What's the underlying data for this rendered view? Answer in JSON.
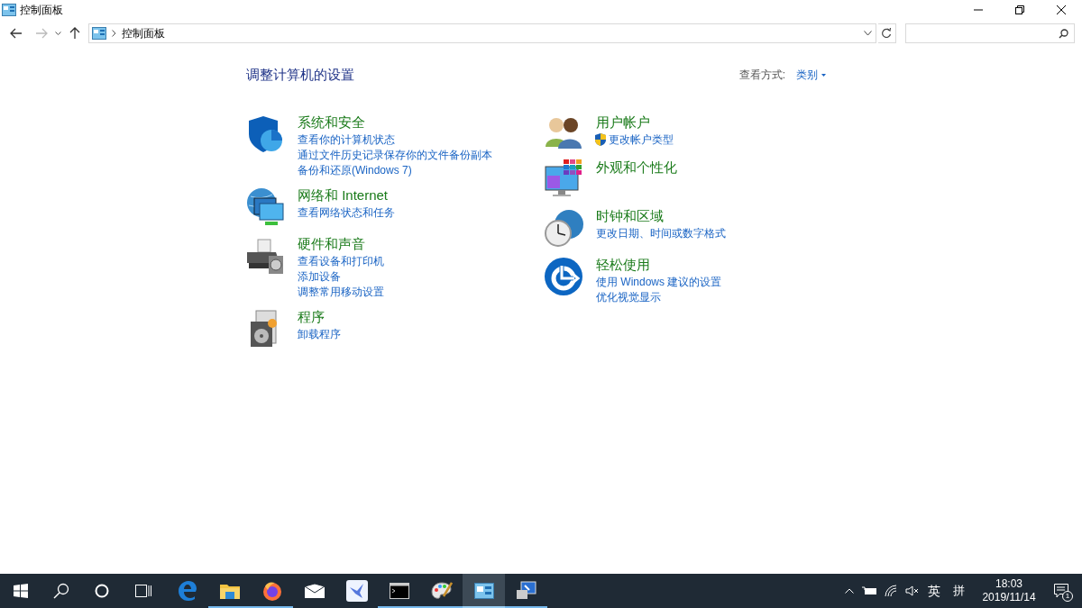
{
  "window": {
    "title": "控制面板"
  },
  "address_bar": {
    "crumb": "控制面板"
  },
  "heading": "调整计算机的设置",
  "view_by": {
    "label": "查看方式:",
    "value": "类别"
  },
  "columns": [
    {
      "categories": [
        {
          "title": "系统和安全",
          "links": [
            {
              "text": "查看你的计算机状态",
              "shield": false
            },
            {
              "text": "通过文件历史记录保存你的文件备份副本",
              "shield": false
            },
            {
              "text": "备份和还原(Windows 7)",
              "shield": false
            }
          ]
        },
        {
          "title": "网络和 Internet",
          "links": [
            {
              "text": "查看网络状态和任务",
              "shield": false
            }
          ]
        },
        {
          "title": "硬件和声音",
          "links": [
            {
              "text": "查看设备和打印机",
              "shield": false
            },
            {
              "text": "添加设备",
              "shield": false
            },
            {
              "text": "调整常用移动设置",
              "shield": false
            }
          ]
        },
        {
          "title": "程序",
          "links": [
            {
              "text": "卸载程序",
              "shield": false
            }
          ]
        }
      ]
    },
    {
      "categories": [
        {
          "title": "用户帐户",
          "links": [
            {
              "text": "更改帐户类型",
              "shield": true
            }
          ]
        },
        {
          "title": "外观和个性化"
        },
        {
          "title": "时钟和区域",
          "links": [
            {
              "text": "更改日期、时间或数字格式",
              "shield": false
            }
          ]
        },
        {
          "title": "轻松使用",
          "links": [
            {
              "text": "使用 Windows 建议的设置",
              "shield": false
            },
            {
              "text": "优化视觉显示",
              "shield": false
            }
          ]
        }
      ]
    }
  ],
  "taskbar": {
    "apps": [
      {
        "running": false,
        "selected": false
      },
      {
        "running": true,
        "selected": false
      },
      {
        "running": true,
        "selected": false
      },
      {
        "running": false,
        "selected": false
      },
      {
        "running": false,
        "selected": false
      },
      {
        "running": true,
        "selected": false
      },
      {
        "running": true,
        "selected": false
      },
      {
        "running": true,
        "selected": true
      },
      {
        "running": true,
        "selected": false
      }
    ],
    "ime_mode": "英",
    "ime": "拼",
    "time": "18:03",
    "date": "2019/11/14",
    "notifications": "1"
  }
}
